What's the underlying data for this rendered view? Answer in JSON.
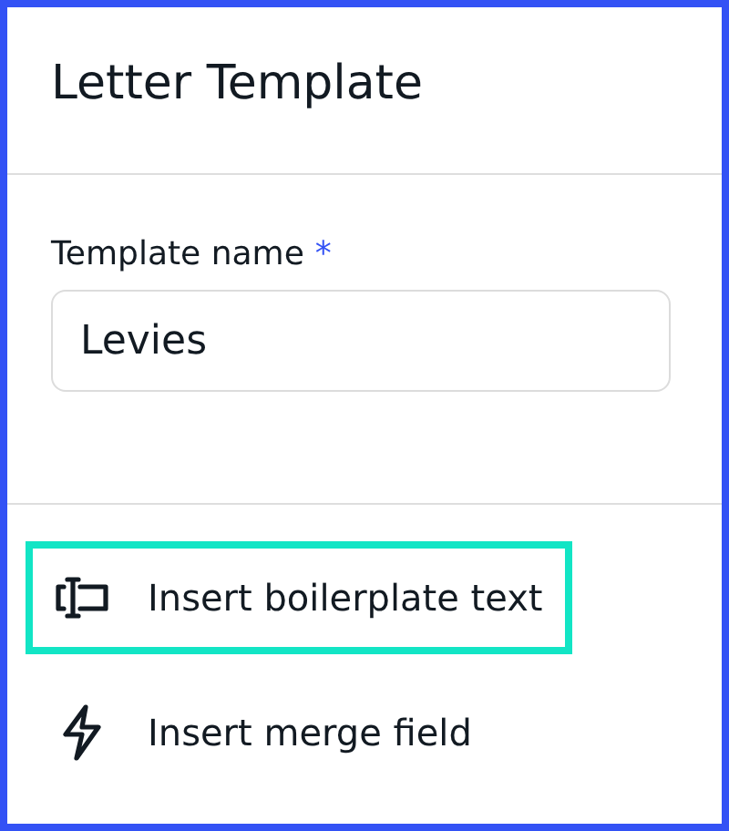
{
  "panel": {
    "title": "Letter Template"
  },
  "form": {
    "label": "Template name",
    "required": true,
    "required_mark": "*",
    "value": "Levies"
  },
  "actions": [
    {
      "kind": "boilerplate",
      "label": "Insert boilerplate text",
      "highlighted": true
    },
    {
      "kind": "merge",
      "label": "Insert merge field",
      "highlighted": false
    }
  ]
}
